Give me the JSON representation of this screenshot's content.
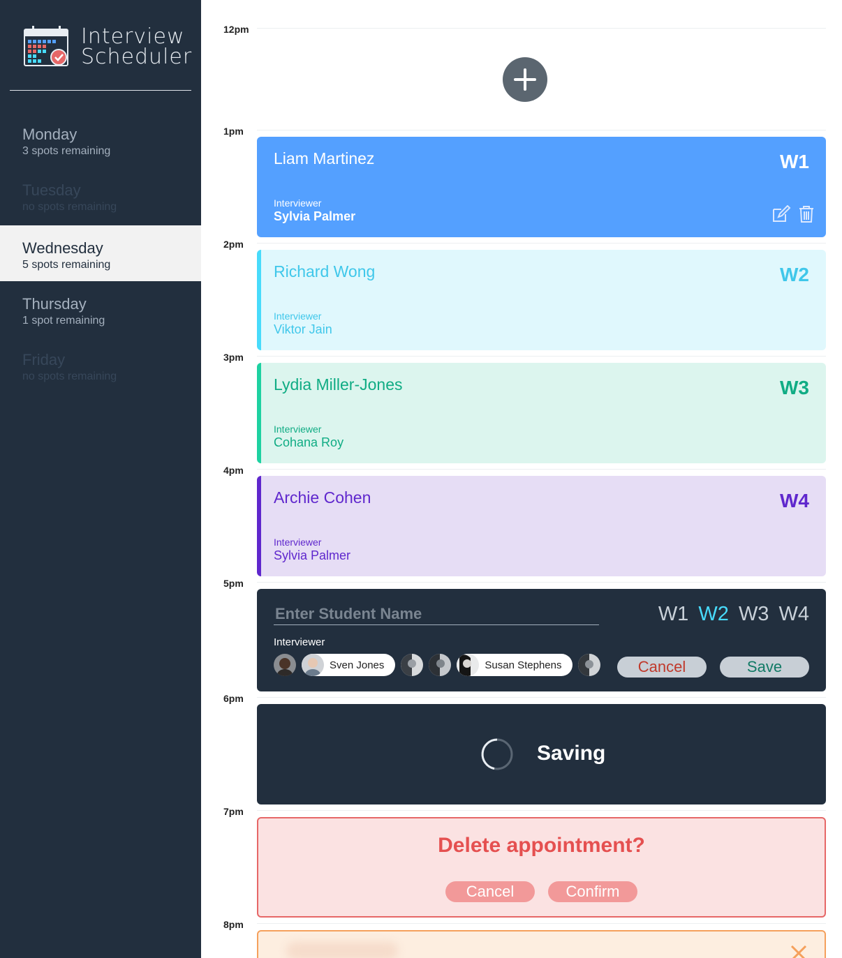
{
  "app": {
    "title_line1": "Interview",
    "title_line2": "Scheduler"
  },
  "days": [
    {
      "name": "Monday",
      "spots": "3 spots remaining",
      "state": "normal"
    },
    {
      "name": "Tuesday",
      "spots": "no spots remaining",
      "state": "full"
    },
    {
      "name": "Wednesday",
      "spots": "5 spots remaining",
      "state": "selected"
    },
    {
      "name": "Thursday",
      "spots": "1 spot remaining",
      "state": "normal"
    },
    {
      "name": "Friday",
      "spots": "no spots remaining",
      "state": "full"
    }
  ],
  "hours": [
    "12pm",
    "1pm",
    "2pm",
    "3pm",
    "4pm",
    "5pm",
    "6pm",
    "7pm",
    "8pm"
  ],
  "appointments": [
    {
      "student": "Liam Martinez",
      "interviewer_label": "Interviewer",
      "interviewer": "Sylvia Palmer",
      "week": "W1",
      "color": "#54a0ff"
    },
    {
      "student": "Richard Wong",
      "interviewer_label": "Interviewer",
      "interviewer": "Viktor Jain",
      "week": "W2",
      "color": "#48dbfb"
    },
    {
      "student": "Lydia Miller-Jones",
      "interviewer_label": "Interviewer",
      "interviewer": "Cohana Roy",
      "week": "W3",
      "color": "#1dd1a1"
    },
    {
      "student": "Archie Cohen",
      "interviewer_label": "Interviewer",
      "interviewer": "Sylvia Palmer",
      "week": "W4",
      "color": "#5f27cd"
    }
  ],
  "form": {
    "placeholder": "Enter Student Name",
    "weeks": [
      "W1",
      "W2",
      "W3",
      "W4"
    ],
    "selected_week": "W2",
    "interviewer_label": "Interviewer",
    "interviewers": [
      {
        "name": "",
        "selected": false
      },
      {
        "name": "Sven Jones",
        "selected": true
      },
      {
        "name": "",
        "selected": false
      },
      {
        "name": "",
        "selected": false
      },
      {
        "name": "Susan Stephens",
        "selected": true
      },
      {
        "name": "",
        "selected": false
      }
    ],
    "cancel": "Cancel",
    "save": "Save"
  },
  "saving": {
    "text": "Saving"
  },
  "confirm": {
    "message": "Delete appointment?",
    "cancel": "Cancel",
    "confirm": "Confirm"
  },
  "colors": {
    "sidebar": "#222f3e",
    "selected_day": "#f2f2f2",
    "error_border": "#f5a05c"
  }
}
